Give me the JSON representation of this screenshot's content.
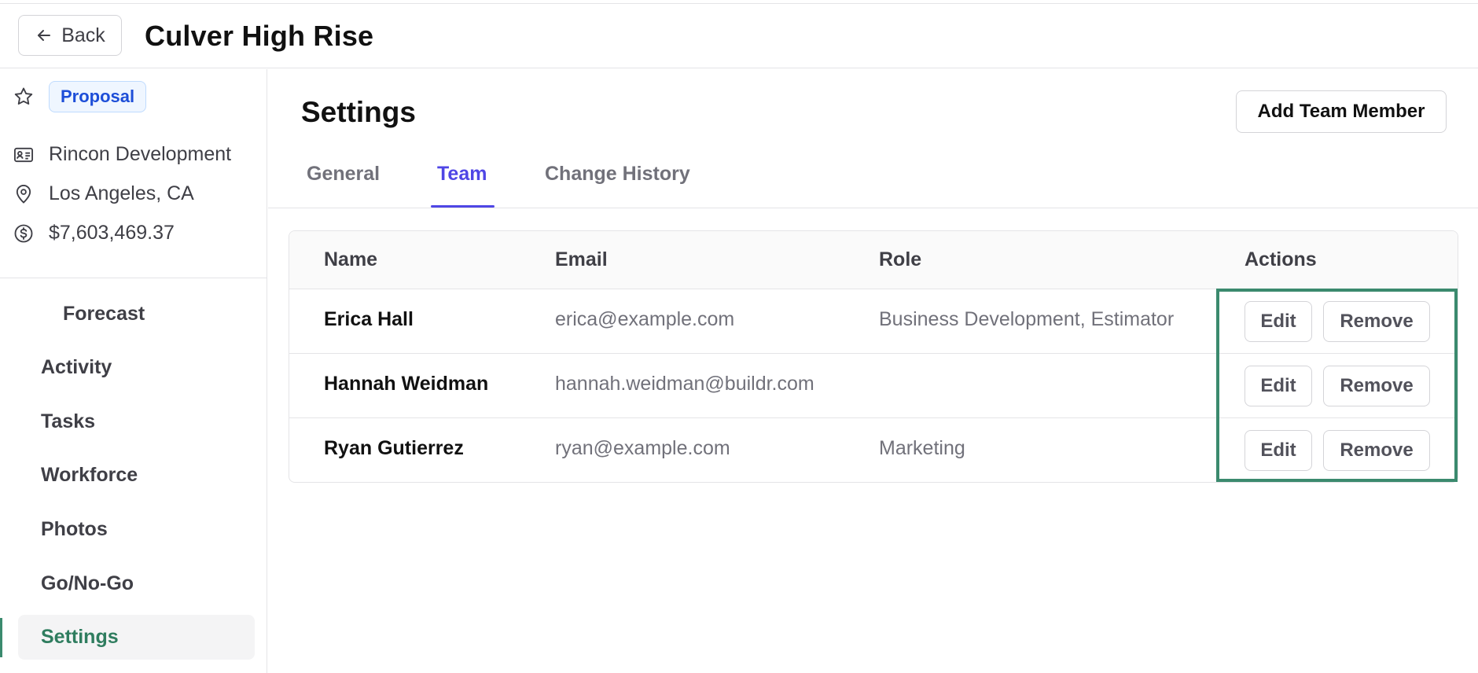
{
  "header": {
    "back_label": "Back",
    "project_title": "Culver High Rise"
  },
  "sidebar": {
    "status_badge": "Proposal",
    "company": "Rincon Development",
    "location": "Los Angeles, CA",
    "amount": "$7,603,469.37",
    "nav": [
      {
        "label": "Forecast"
      },
      {
        "label": "Activity"
      },
      {
        "label": "Tasks"
      },
      {
        "label": "Workforce"
      },
      {
        "label": "Photos"
      },
      {
        "label": "Go/No-Go"
      },
      {
        "label": "Settings",
        "active": true
      }
    ]
  },
  "main": {
    "title": "Settings",
    "add_button": "Add Team Member",
    "tabs": [
      {
        "label": "General"
      },
      {
        "label": "Team",
        "active": true
      },
      {
        "label": "Change History"
      }
    ],
    "table": {
      "columns": [
        "Name",
        "Email",
        "Role",
        "Actions"
      ],
      "rows": [
        {
          "name": "Erica Hall",
          "email": "erica@example.com",
          "role": "Business Development, Estimator",
          "edit": "Edit",
          "remove": "Remove"
        },
        {
          "name": "Hannah Weidman",
          "email": "hannah.weidman@buildr.com",
          "role": "",
          "edit": "Edit",
          "remove": "Remove"
        },
        {
          "name": "Ryan Gutierrez",
          "email": "ryan@example.com",
          "role": "Marketing",
          "edit": "Edit",
          "remove": "Remove"
        }
      ]
    }
  },
  "colors": {
    "accent_tab": "#4f46e5",
    "active_nav": "#2f7d5f",
    "highlight_box": "#3b8a6e",
    "badge_text": "#1d4ed8"
  },
  "icons": {
    "back": "arrow-left-icon",
    "status": "star-icon",
    "company": "id-card-icon",
    "location": "map-pin-icon",
    "amount": "dollar-circle-icon"
  }
}
